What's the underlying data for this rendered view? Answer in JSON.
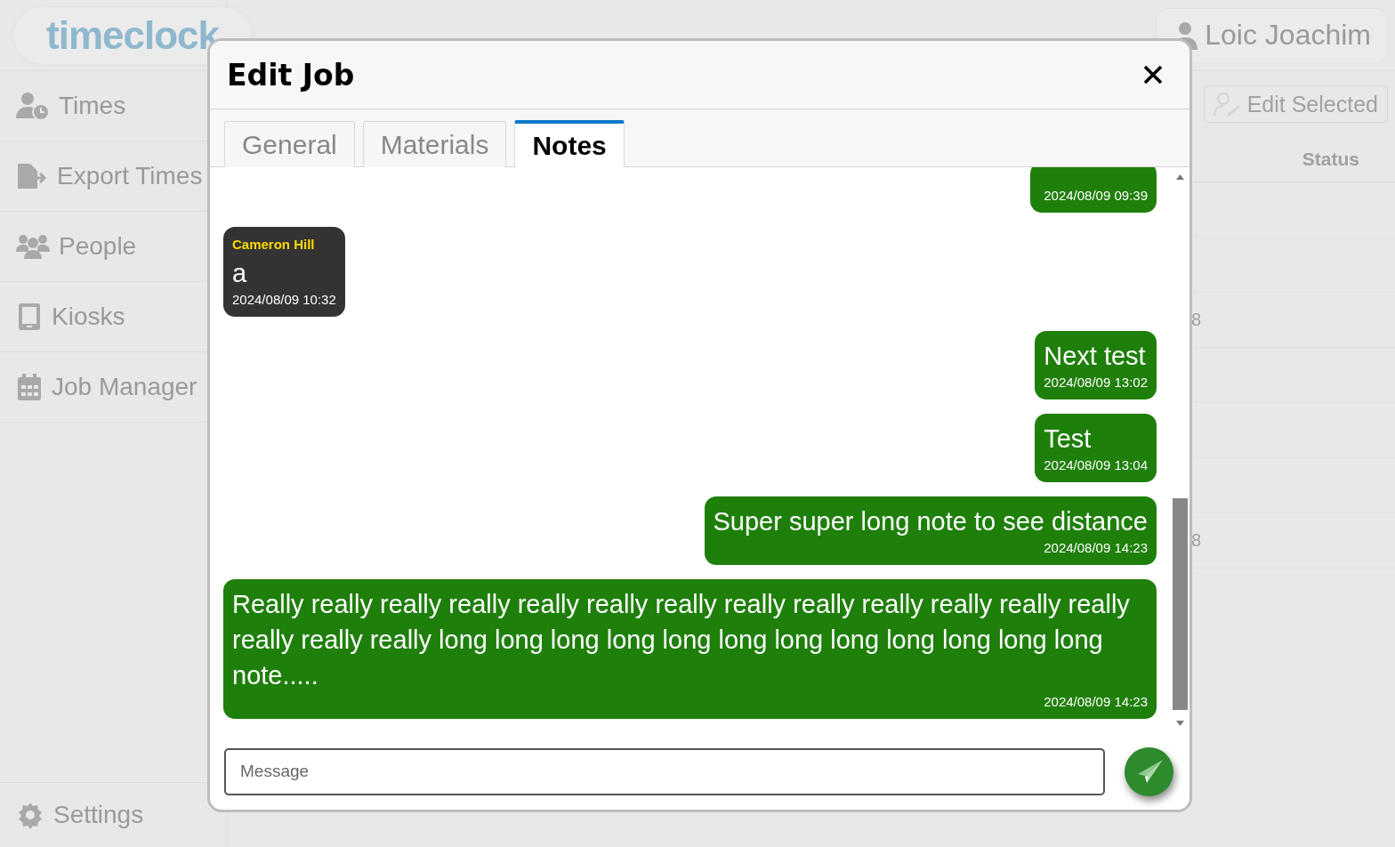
{
  "app": {
    "logo": {
      "first": "timeclock"
    },
    "nav": [
      {
        "label": "Times"
      },
      {
        "label": "Export Times"
      },
      {
        "label": "People"
      },
      {
        "label": "Kiosks"
      },
      {
        "label": "Job Manager"
      }
    ],
    "settings": {
      "label": "Settings"
    },
    "user": {
      "name": "Loic Joachim"
    },
    "toolbar": {
      "button": "Edit Selected"
    },
    "table": {
      "columns": [
        "Status"
      ],
      "cells": [
        "8",
        "8"
      ]
    }
  },
  "modal": {
    "title": "Edit Job",
    "tabs": [
      {
        "label": "General",
        "selected": false
      },
      {
        "label": "Materials",
        "selected": false
      },
      {
        "label": "Notes",
        "selected": true
      }
    ],
    "messages": [
      {
        "kind": "sent",
        "time": "2024/08/09 09:39"
      },
      {
        "kind": "received",
        "author": "Cameron Hill",
        "text": "a",
        "time": "2024/08/09 10:32"
      },
      {
        "kind": "sent",
        "text": "Next test",
        "time": "2024/08/09 13:02"
      },
      {
        "kind": "sent",
        "text": "Test",
        "time": "2024/08/09 13:04"
      },
      {
        "kind": "sent",
        "text": "Super super long note to see distance",
        "time": "2024/08/09 14:23"
      },
      {
        "kind": "sent",
        "text": "Really really really really really really really really really really really really really really really really long long long long long long long long long long long long note.....",
        "time": "2024/08/09 14:23"
      }
    ],
    "composer": {
      "placeholder": "Message"
    }
  }
}
